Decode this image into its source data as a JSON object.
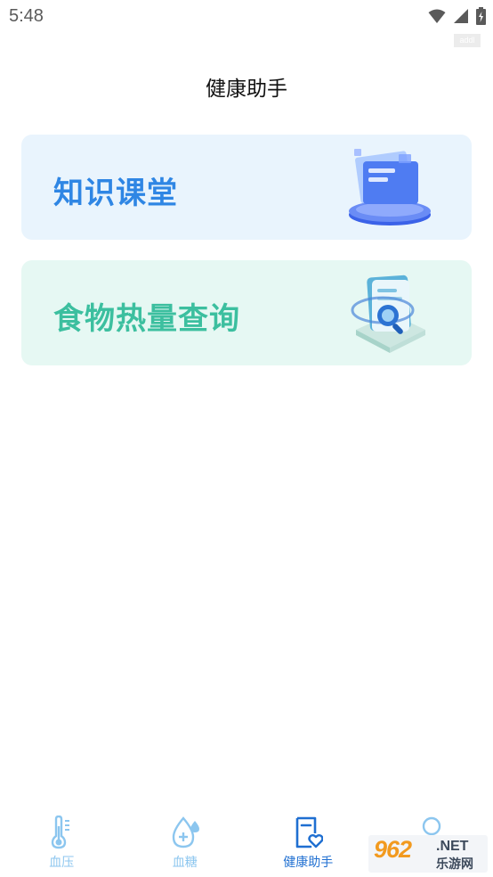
{
  "status_bar": {
    "time": "5:48",
    "icons": [
      "wifi-icon",
      "signal-icon",
      "battery-charging-icon"
    ],
    "corner_tag": "addl"
  },
  "header": {
    "title": "健康助手"
  },
  "cards": [
    {
      "label": "知识课堂",
      "icon": "folder-3d-icon",
      "color": "#2f86e4",
      "background": "#e9f4fd"
    },
    {
      "label": "食物热量查询",
      "icon": "document-search-3d-icon",
      "color": "#3cbf9f",
      "background": "#e6f8f3"
    }
  ],
  "tabbar": {
    "tabs": [
      {
        "label": "血压",
        "icon": "thermometer-icon",
        "active": false
      },
      {
        "label": "血糖",
        "icon": "drop-plus-icon",
        "active": false
      },
      {
        "label": "健康助手",
        "icon": "health-doc-heart-icon",
        "active": true
      },
      {
        "label": "",
        "icon": "person-icon",
        "active": false
      }
    ],
    "active_color": "#1f6fd1",
    "inactive_color": "#8cc6ef"
  },
  "watermark": {
    "logo": "962",
    "suffix": ".NET",
    "text": "乐游网"
  }
}
